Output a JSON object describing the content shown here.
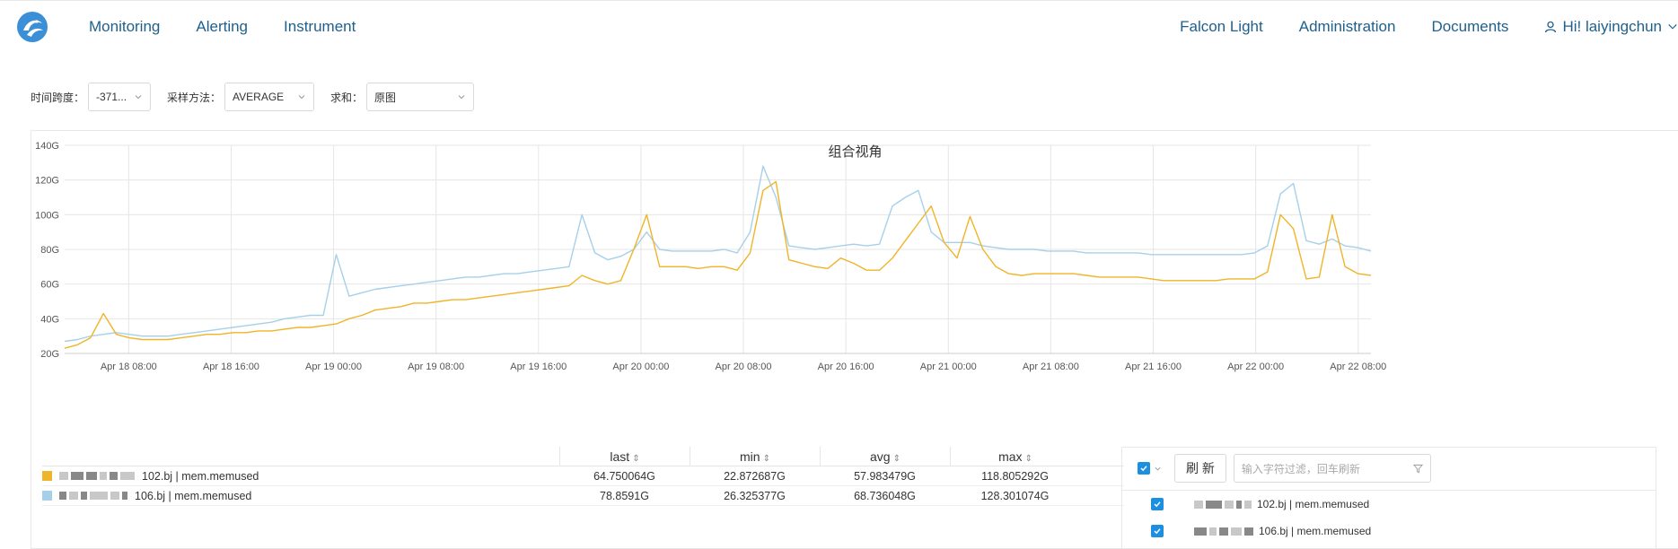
{
  "nav": {
    "left": [
      "Monitoring",
      "Alerting",
      "Instrument"
    ],
    "right": [
      "Falcon Light",
      "Administration",
      "Documents"
    ],
    "user": "Hi! laiyingchun"
  },
  "filters": {
    "time_label": "时间跨度：",
    "time_value": "-371...",
    "sample_label": "采样方法：",
    "sample_value": "AVERAGE",
    "sum_label": "求和：",
    "sum_value": "原图"
  },
  "chart_data": {
    "type": "line",
    "title": "组合视角",
    "ylim": [
      20,
      140
    ],
    "yticks": [
      "20G",
      "40G",
      "60G",
      "80G",
      "100G",
      "120G",
      "140G"
    ],
    "x_start": "Apr 18 03:00",
    "x_end": "Apr 22 09:00",
    "xticks": [
      "Apr 18 08:00",
      "Apr 18 16:00",
      "Apr 19 00:00",
      "Apr 19 08:00",
      "Apr 19 16:00",
      "Apr 20 00:00",
      "Apr 20 08:00",
      "Apr 20 16:00",
      "Apr 21 00:00",
      "Apr 21 08:00",
      "Apr 21 16:00",
      "Apr 22 00:00",
      "Apr 22 08:00"
    ],
    "grid": true,
    "series": [
      {
        "color": "#f0b429",
        "values": [
          23,
          25,
          29,
          43,
          31,
          29,
          28,
          28,
          28,
          29,
          30,
          31,
          31,
          32,
          32,
          33,
          33,
          34,
          35,
          35,
          36,
          37,
          40,
          42,
          45,
          46,
          47,
          49,
          49,
          50,
          51,
          51,
          52,
          53,
          54,
          55,
          56,
          57,
          58,
          59,
          65,
          62,
          60,
          62,
          80,
          100,
          70,
          70,
          70,
          69,
          70,
          70,
          68,
          78,
          114,
          119,
          74,
          72,
          70,
          69,
          75,
          72,
          68,
          68,
          75,
          85,
          95,
          105,
          84,
          75,
          99,
          80,
          70,
          66,
          65,
          66,
          66,
          66,
          66,
          65,
          64,
          64,
          64,
          64,
          63,
          62,
          62,
          62,
          62,
          62,
          63,
          63,
          63,
          67,
          100,
          92,
          63,
          64,
          100,
          70,
          66,
          65
        ]
      },
      {
        "color": "#a6d0ea",
        "values": [
          27,
          28,
          30,
          31,
          32,
          31,
          30,
          30,
          30,
          31,
          32,
          33,
          34,
          35,
          36,
          37,
          38,
          40,
          41,
          42,
          42,
          77,
          53,
          55,
          57,
          58,
          59,
          60,
          61,
          62,
          63,
          64,
          64,
          65,
          66,
          66,
          67,
          68,
          69,
          70,
          100,
          78,
          74,
          76,
          80,
          90,
          80,
          79,
          79,
          79,
          79,
          80,
          78,
          90,
          128,
          110,
          82,
          81,
          80,
          81,
          82,
          83,
          82,
          83,
          105,
          110,
          114,
          90,
          84,
          84,
          84,
          82,
          81,
          80,
          80,
          80,
          79,
          79,
          79,
          78,
          78,
          78,
          78,
          78,
          77,
          77,
          77,
          77,
          77,
          77,
          77,
          77,
          78,
          82,
          112,
          118,
          85,
          83,
          86,
          82,
          81,
          79
        ]
      }
    ]
  },
  "legend": {
    "columns": [
      "last",
      "min",
      "avg",
      "max"
    ],
    "sort_icon": "⇕",
    "rows": [
      {
        "color": "#f0b429",
        "name": "102.bj | mem.memused",
        "last": "64.750064G",
        "min": "22.872687G",
        "avg": "57.983479G",
        "max": "118.805292G"
      },
      {
        "color": "#a6d0ea",
        "name": "106.bj | mem.memused",
        "last": "78.8591G",
        "min": "26.325377G",
        "avg": "68.736048G",
        "max": "128.301074G"
      }
    ]
  },
  "rightpanel": {
    "refresh_label": "刷 新",
    "search_placeholder": "输入字符过滤，回车刷新",
    "items": [
      "102.bj | mem.memused",
      "106.bj | mem.memused"
    ]
  }
}
